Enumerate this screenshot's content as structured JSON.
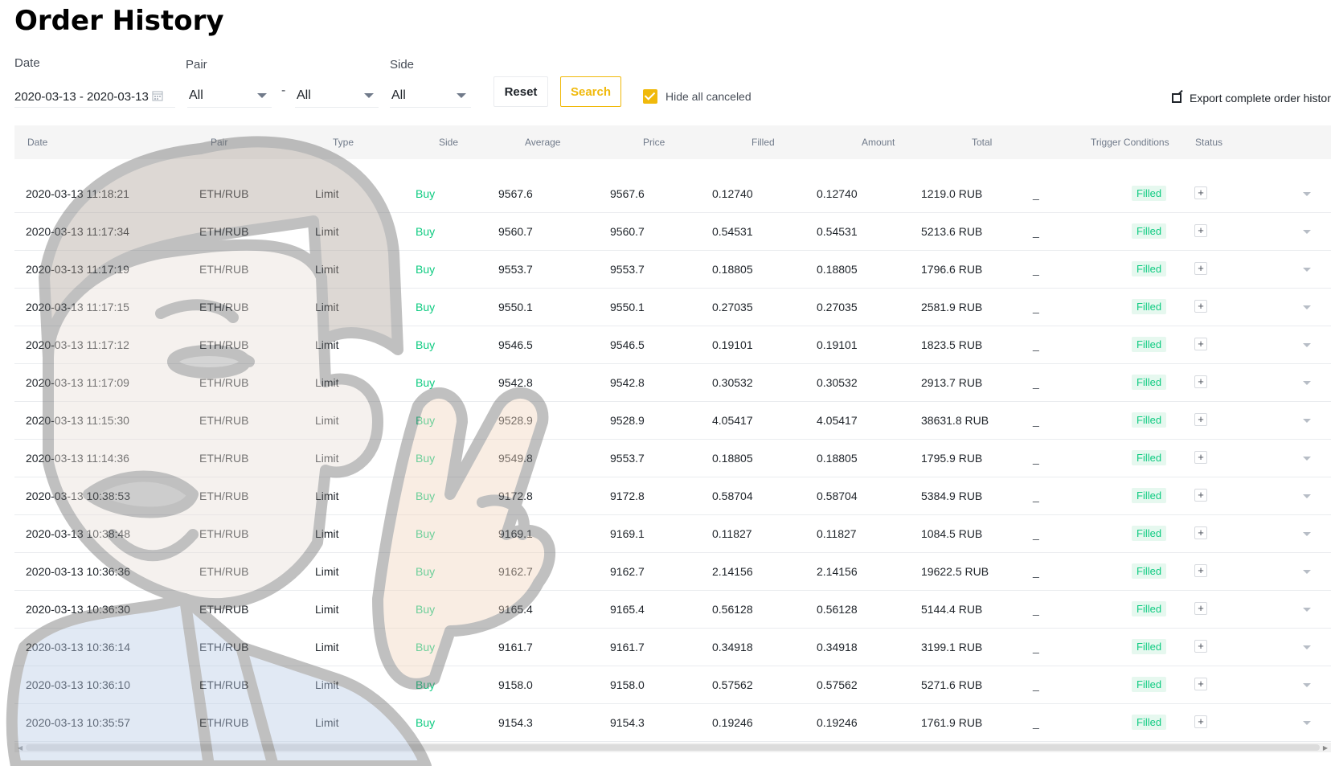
{
  "page": {
    "title": "Order History"
  },
  "filters": {
    "date_label": "Date",
    "date_value": "2020-03-13 - 2020-03-13",
    "pair_label": "Pair",
    "pair_base": "All",
    "pair_separator": "-",
    "pair_quote": "All",
    "side_label": "Side",
    "side_value": "All",
    "reset_label": "Reset",
    "search_label": "Search",
    "hide_canceled_label": "Hide all canceled",
    "export_label": "Export complete order history"
  },
  "table": {
    "columns": [
      "Date",
      "Pair",
      "Type",
      "Side",
      "Average",
      "Price",
      "Filled",
      "Amount",
      "Total",
      "Trigger Conditions",
      "Status"
    ],
    "rows": [
      {
        "date": "2020-03-13 11:18:21",
        "pair": "ETH/RUB",
        "type": "Limit",
        "side": "Buy",
        "average": "9567.6",
        "price": "9567.6",
        "filled": "0.12740",
        "amount": "0.12740",
        "total": "1219.0 RUB",
        "trigger": "_",
        "status": "Filled"
      },
      {
        "date": "2020-03-13 11:17:34",
        "pair": "ETH/RUB",
        "type": "Limit",
        "side": "Buy",
        "average": "9560.7",
        "price": "9560.7",
        "filled": "0.54531",
        "amount": "0.54531",
        "total": "5213.6 RUB",
        "trigger": "_",
        "status": "Filled"
      },
      {
        "date": "2020-03-13 11:17:19",
        "pair": "ETH/RUB",
        "type": "Limit",
        "side": "Buy",
        "average": "9553.7",
        "price": "9553.7",
        "filled": "0.18805",
        "amount": "0.18805",
        "total": "1796.6 RUB",
        "trigger": "_",
        "status": "Filled"
      },
      {
        "date": "2020-03-13 11:17:15",
        "pair": "ETH/RUB",
        "type": "Limit",
        "side": "Buy",
        "average": "9550.1",
        "price": "9550.1",
        "filled": "0.27035",
        "amount": "0.27035",
        "total": "2581.9 RUB",
        "trigger": "_",
        "status": "Filled"
      },
      {
        "date": "2020-03-13 11:17:12",
        "pair": "ETH/RUB",
        "type": "Limit",
        "side": "Buy",
        "average": "9546.5",
        "price": "9546.5",
        "filled": "0.19101",
        "amount": "0.19101",
        "total": "1823.5 RUB",
        "trigger": "_",
        "status": "Filled"
      },
      {
        "date": "2020-03-13 11:17:09",
        "pair": "ETH/RUB",
        "type": "Limit",
        "side": "Buy",
        "average": "9542.8",
        "price": "9542.8",
        "filled": "0.30532",
        "amount": "0.30532",
        "total": "2913.7 RUB",
        "trigger": "_",
        "status": "Filled"
      },
      {
        "date": "2020-03-13 11:15:30",
        "pair": "ETH/RUB",
        "type": "Limit",
        "side": "Buy",
        "average": "9528.9",
        "price": "9528.9",
        "filled": "4.05417",
        "amount": "4.05417",
        "total": "38631.8 RUB",
        "trigger": "_",
        "status": "Filled"
      },
      {
        "date": "2020-03-13 11:14:36",
        "pair": "ETH/RUB",
        "type": "Limit",
        "side": "Buy",
        "average": "9549.8",
        "price": "9553.7",
        "filled": "0.18805",
        "amount": "0.18805",
        "total": "1795.9 RUB",
        "trigger": "_",
        "status": "Filled"
      },
      {
        "date": "2020-03-13 10:38:53",
        "pair": "ETH/RUB",
        "type": "Limit",
        "side": "Buy",
        "average": "9172.8",
        "price": "9172.8",
        "filled": "0.58704",
        "amount": "0.58704",
        "total": "5384.9 RUB",
        "trigger": "_",
        "status": "Filled"
      },
      {
        "date": "2020-03-13 10:38:48",
        "pair": "ETH/RUB",
        "type": "Limit",
        "side": "Buy",
        "average": "9169.1",
        "price": "9169.1",
        "filled": "0.11827",
        "amount": "0.11827",
        "total": "1084.5 RUB",
        "trigger": "_",
        "status": "Filled"
      },
      {
        "date": "2020-03-13 10:36:36",
        "pair": "ETH/RUB",
        "type": "Limit",
        "side": "Buy",
        "average": "9162.7",
        "price": "9162.7",
        "filled": "2.14156",
        "amount": "2.14156",
        "total": "19622.5 RUB",
        "trigger": "_",
        "status": "Filled"
      },
      {
        "date": "2020-03-13 10:36:30",
        "pair": "ETH/RUB",
        "type": "Limit",
        "side": "Buy",
        "average": "9165.4",
        "price": "9165.4",
        "filled": "0.56128",
        "amount": "0.56128",
        "total": "5144.4 RUB",
        "trigger": "_",
        "status": "Filled"
      },
      {
        "date": "2020-03-13 10:36:14",
        "pair": "ETH/RUB",
        "type": "Limit",
        "side": "Buy",
        "average": "9161.7",
        "price": "9161.7",
        "filled": "0.34918",
        "amount": "0.34918",
        "total": "3199.1 RUB",
        "trigger": "_",
        "status": "Filled"
      },
      {
        "date": "2020-03-13 10:36:10",
        "pair": "ETH/RUB",
        "type": "Limit",
        "side": "Buy",
        "average": "9158.0",
        "price": "9158.0",
        "filled": "0.57562",
        "amount": "0.57562",
        "total": "5271.6 RUB",
        "trigger": "_",
        "status": "Filled"
      },
      {
        "date": "2020-03-13 10:35:57",
        "pair": "ETH/RUB",
        "type": "Limit",
        "side": "Buy",
        "average": "9154.3",
        "price": "9154.3",
        "filled": "0.19246",
        "amount": "0.19246",
        "total": "1761.9 RUB",
        "trigger": "_",
        "status": "Filled"
      }
    ],
    "row_expand_symbol": "+"
  },
  "colors": {
    "accent": "#f0b90b",
    "buy": "#0ecb81",
    "filled_badge_bg": "#e6f8ef",
    "header_bg": "#f5f5f5"
  },
  "icons": {
    "date_picker": "calendar-icon",
    "export": "external-link-icon",
    "select": "chevron-down-icon",
    "row_expand": "plus-icon",
    "row_detail": "caret-down-icon",
    "overlay": "mascot-illustration"
  }
}
